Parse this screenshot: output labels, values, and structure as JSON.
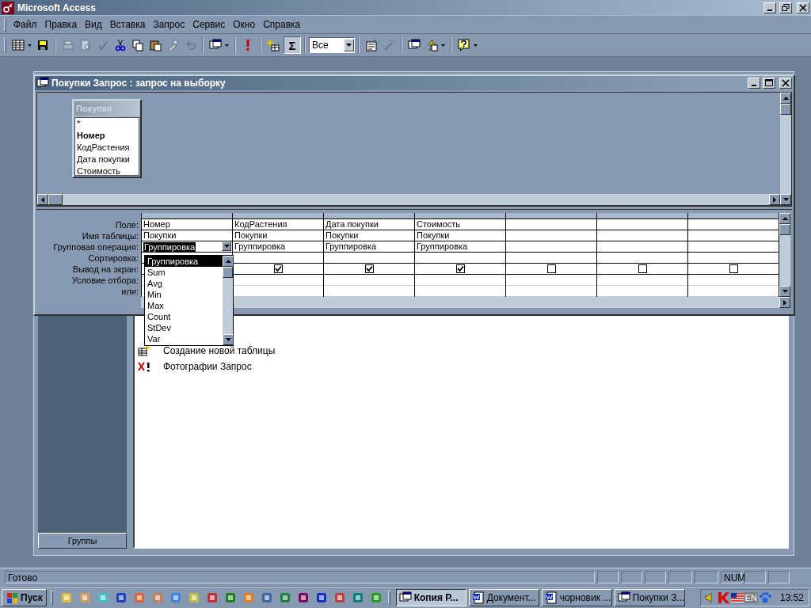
{
  "app": {
    "title": "Microsoft Access"
  },
  "menu": [
    "Файл",
    "Правка",
    "Вид",
    "Вставка",
    "Запрос",
    "Сервис",
    "Окно",
    "Справка"
  ],
  "toolbar": {
    "totals_label": "Σ",
    "totals_pressed": true,
    "filter_value": "Все"
  },
  "database_window": {
    "groups_button": "Группы",
    "items": [
      {
        "label": "Создание новой таблицы",
        "kind": "new-table"
      },
      {
        "label": "Фотографии Запрос",
        "kind": "query"
      }
    ]
  },
  "query_window": {
    "title": "Покупки Запрос : запрос на выборку",
    "table": {
      "title": "Покупки",
      "fields": [
        {
          "name": "*",
          "key": false
        },
        {
          "name": "Номер",
          "key": true
        },
        {
          "name": "КодРастения",
          "key": false
        },
        {
          "name": "Дата покупки",
          "key": false
        },
        {
          "name": "Стоимость",
          "key": false
        }
      ]
    },
    "row_labels": [
      "Поле:",
      "Имя таблицы:",
      "Групповая операция:",
      "Сортировка:",
      "Вывод на экран:",
      "Условие отбора:",
      "или:"
    ],
    "columns": [
      {
        "field": "Номер",
        "table": "Покупки",
        "total": "Группировка",
        "editing": true
      },
      {
        "field": "КодРастения",
        "table": "Покупки",
        "total": "Группировка",
        "show": true,
        "editing": false
      },
      {
        "field": "Дата покупки",
        "table": "Покупки",
        "total": "Группировка",
        "show": true,
        "editing": false
      },
      {
        "field": "Стоимость",
        "table": "Покупки",
        "total": "Группировка",
        "show": true,
        "editing": false
      },
      {
        "show": false,
        "editing": false
      },
      {
        "show": false,
        "editing": false
      },
      {
        "show": false,
        "editing": false
      }
    ],
    "dropdown": [
      {
        "label": "Группировка",
        "selected": true
      },
      {
        "label": "Sum",
        "selected": false
      },
      {
        "label": "Avg",
        "selected": false
      },
      {
        "label": "Min",
        "selected": false
      },
      {
        "label": "Max",
        "selected": false
      },
      {
        "label": "Count",
        "selected": false
      },
      {
        "label": "StDev",
        "selected": false
      },
      {
        "label": "Var",
        "selected": false
      }
    ]
  },
  "status_bar": {
    "text": "Готово",
    "indicator": "NUM"
  },
  "taskbar": {
    "start": "Пуск",
    "tasks": [
      {
        "label": "Копия Р...",
        "kind": "database",
        "selected": true
      },
      {
        "label": "Документ...",
        "kind": "word",
        "selected": false
      },
      {
        "label": "чорновик ...",
        "kind": "word",
        "selected": false
      },
      {
        "label": "Покупки З...",
        "kind": "query",
        "selected": false
      }
    ],
    "language": "EN",
    "clock": "13:52"
  }
}
